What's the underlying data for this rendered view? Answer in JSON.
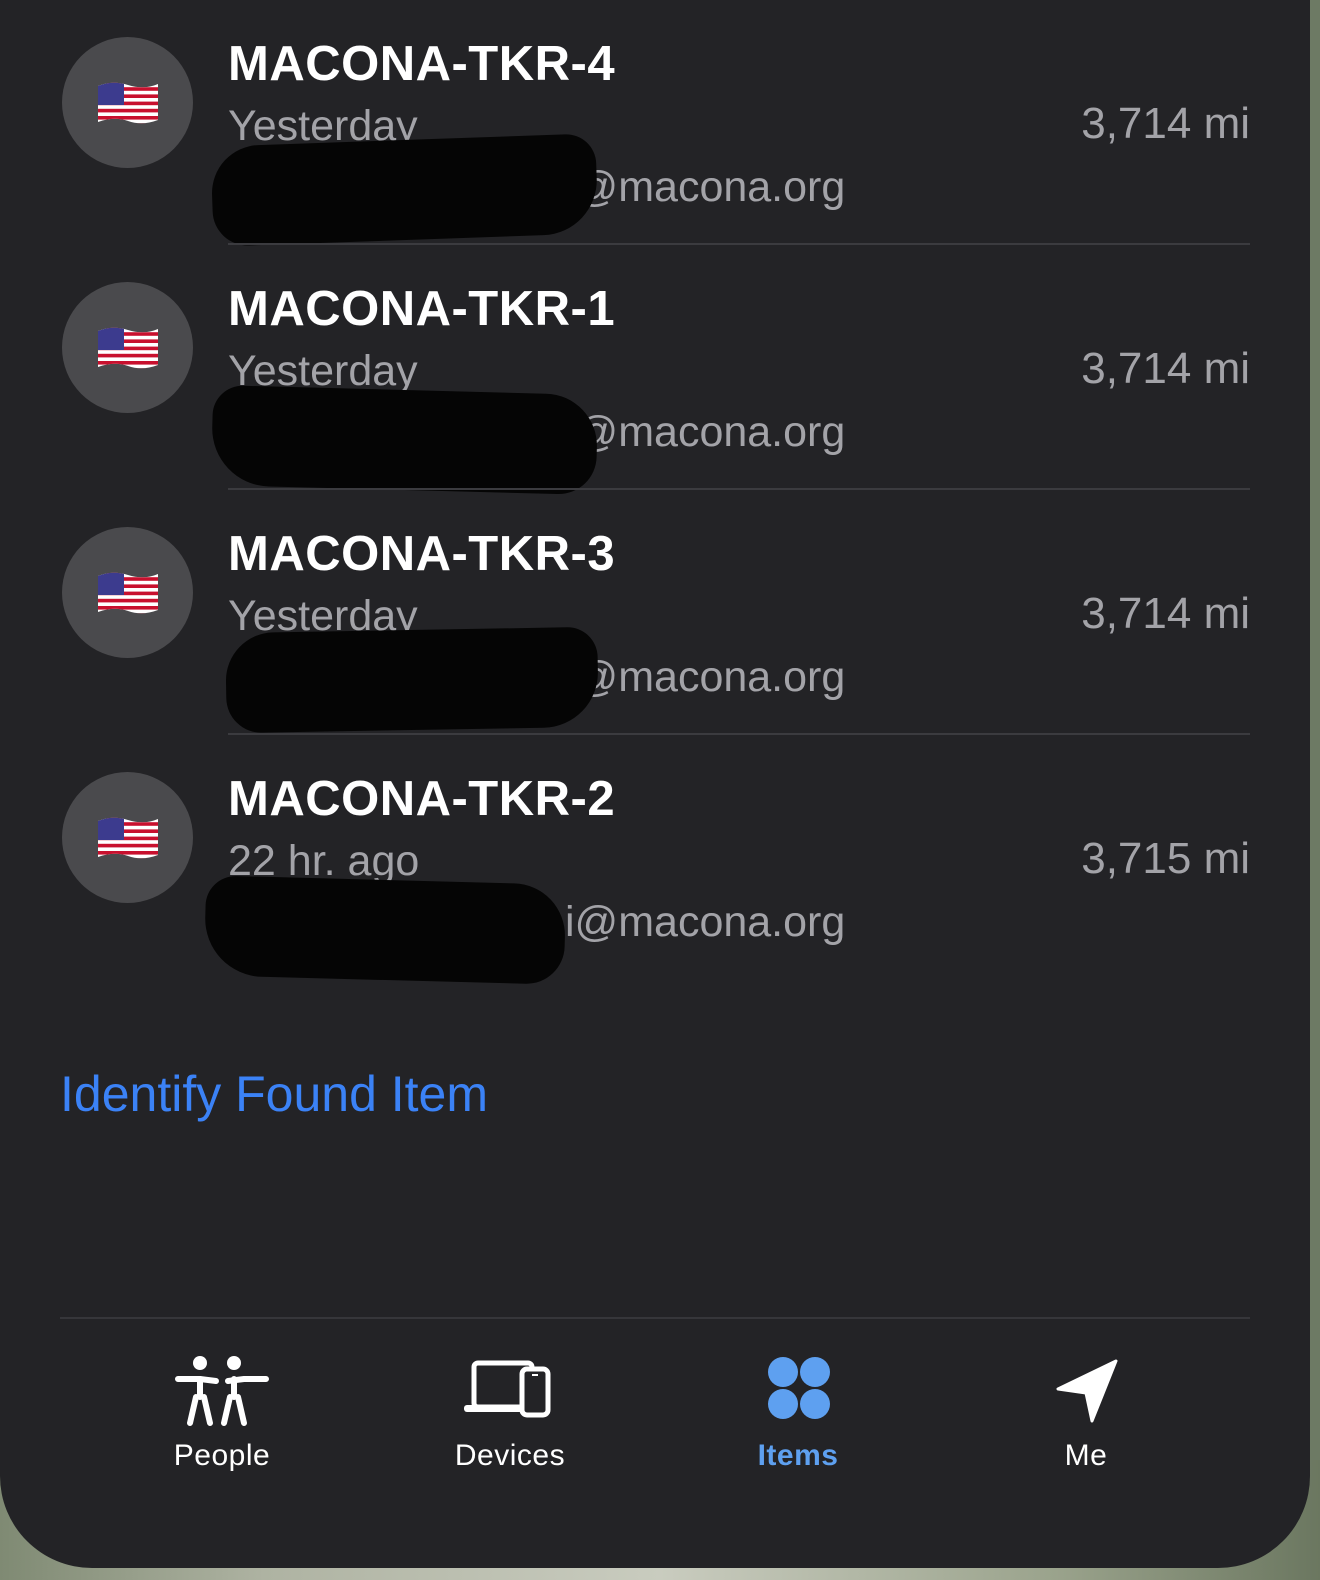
{
  "items": [
    {
      "name": "MACONA-TKR-4",
      "time": "Yesterday",
      "shared": "i@macona.org",
      "distance": "3,714 mi",
      "icon": "us-flag-emoji"
    },
    {
      "name": "MACONA-TKR-1",
      "time": "Yesterday",
      "shared": "i@macona.org",
      "distance": "3,714 mi",
      "icon": "us-flag-emoji"
    },
    {
      "name": "MACONA-TKR-3",
      "time": "Yesterday",
      "shared": "i@macona.org",
      "distance": "3,714 mi",
      "icon": "us-flag-emoji"
    },
    {
      "name": "MACONA-TKR-2",
      "time": "22 hr. ago",
      "shared": "i@macona.org",
      "distance": "3,715 mi",
      "icon": "us-flag-emoji"
    }
  ],
  "identify_link": "Identify Found Item",
  "tabs": [
    {
      "label": "People",
      "icon": "people-icon",
      "active": false
    },
    {
      "label": "Devices",
      "icon": "devices-icon",
      "active": false
    },
    {
      "label": "Items",
      "icon": "items-icon",
      "active": true
    },
    {
      "label": "Me",
      "icon": "location-arrow-icon",
      "active": false
    }
  ],
  "colors": {
    "background": "#232326",
    "accent": "#3b82f6",
    "active_tab": "#5ea0f0",
    "secondary_text": "#a3a3a8",
    "primary_text": "#ffffff"
  }
}
